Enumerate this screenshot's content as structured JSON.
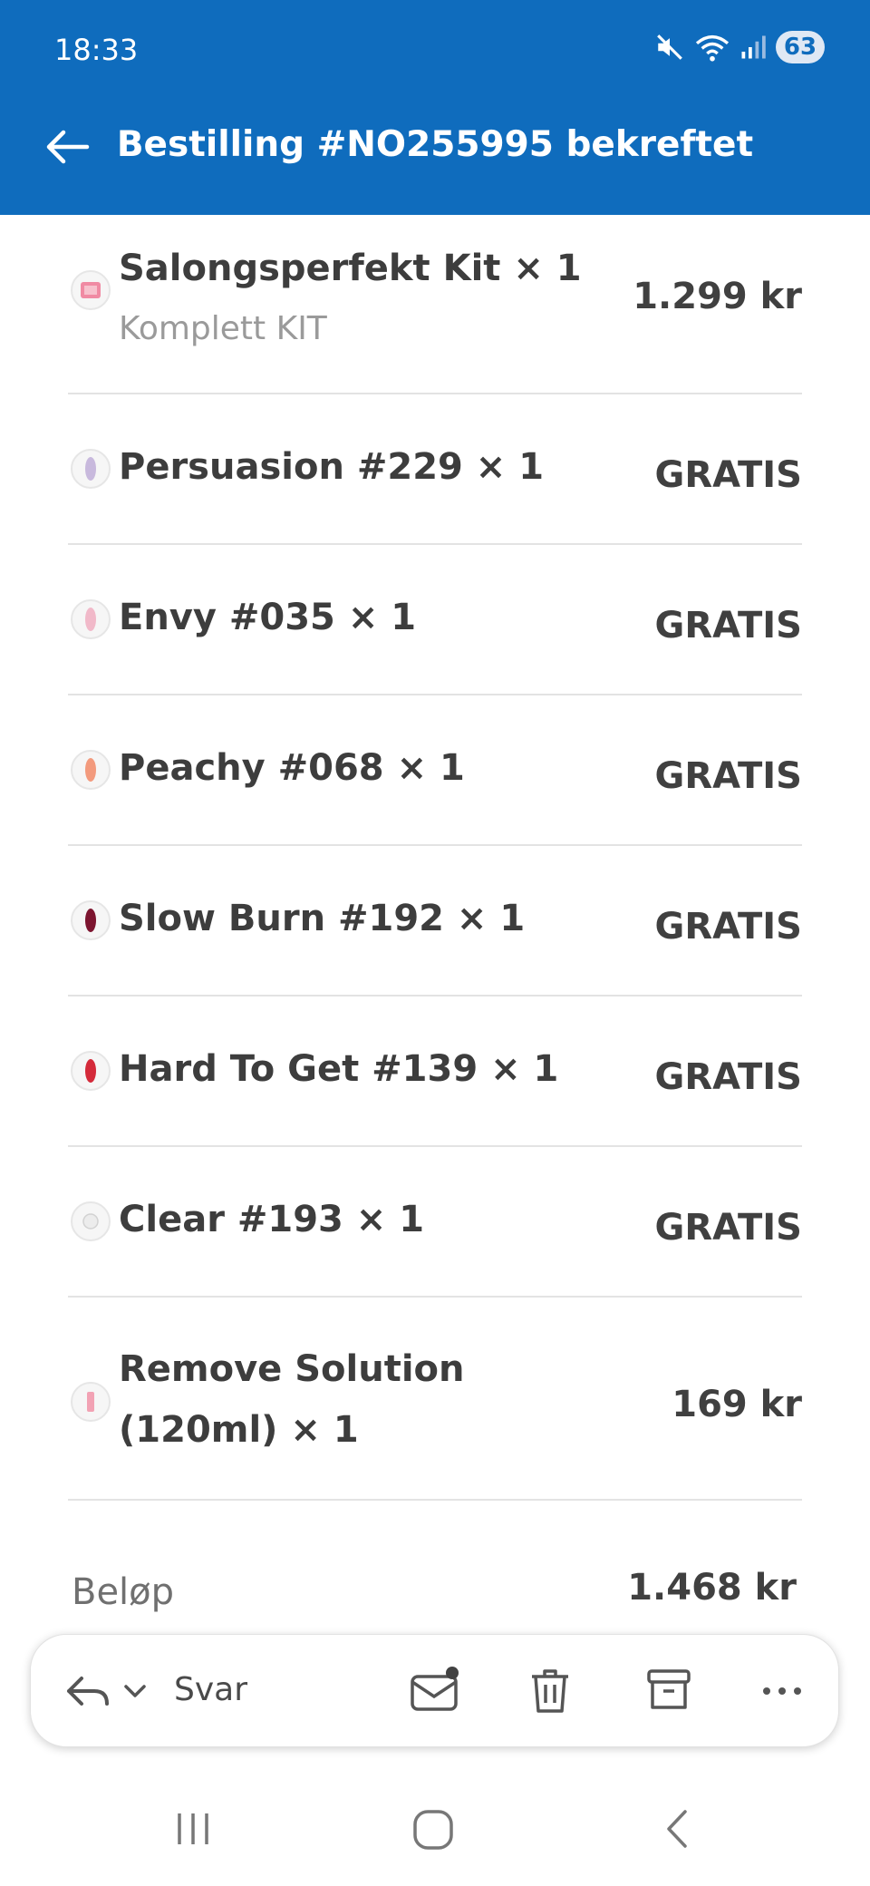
{
  "status_bar": {
    "time": "18:33",
    "battery": "63"
  },
  "header": {
    "title": "Bestilling #NO255995 bekreftet"
  },
  "items": [
    {
      "name": "Salongsperfekt Kit × 1",
      "variant": "Komplett KIT",
      "price": "1.299 kr",
      "color": "#f08aa3"
    },
    {
      "name": "Persuasion #229 × 1",
      "price": "GRATIS",
      "color": "#c8b9dd"
    },
    {
      "name": "Envy #035 × 1",
      "price": "GRATIS",
      "color": "#f1b9c9"
    },
    {
      "name": "Peachy #068 × 1",
      "price": "GRATIS",
      "color": "#f39a7d"
    },
    {
      "name": "Slow Burn #192 × 1",
      "price": "GRATIS",
      "color": "#7d1530"
    },
    {
      "name": "Hard To Get #139 × 1",
      "price": "GRATIS",
      "color": "#d42a3a"
    },
    {
      "name": "Clear #193 × 1",
      "price": "GRATIS",
      "color": "#ececec"
    },
    {
      "name_line1": "Remove Solution",
      "name_line2": "(120ml) × 1",
      "price": "169 kr",
      "color": "#f2a2b4"
    }
  ],
  "summary": {
    "label": "Beløp",
    "value": "1.468 kr"
  },
  "toolbar": {
    "reply_label": "Svar"
  },
  "colors": {
    "accent": "#0f6cbd"
  }
}
